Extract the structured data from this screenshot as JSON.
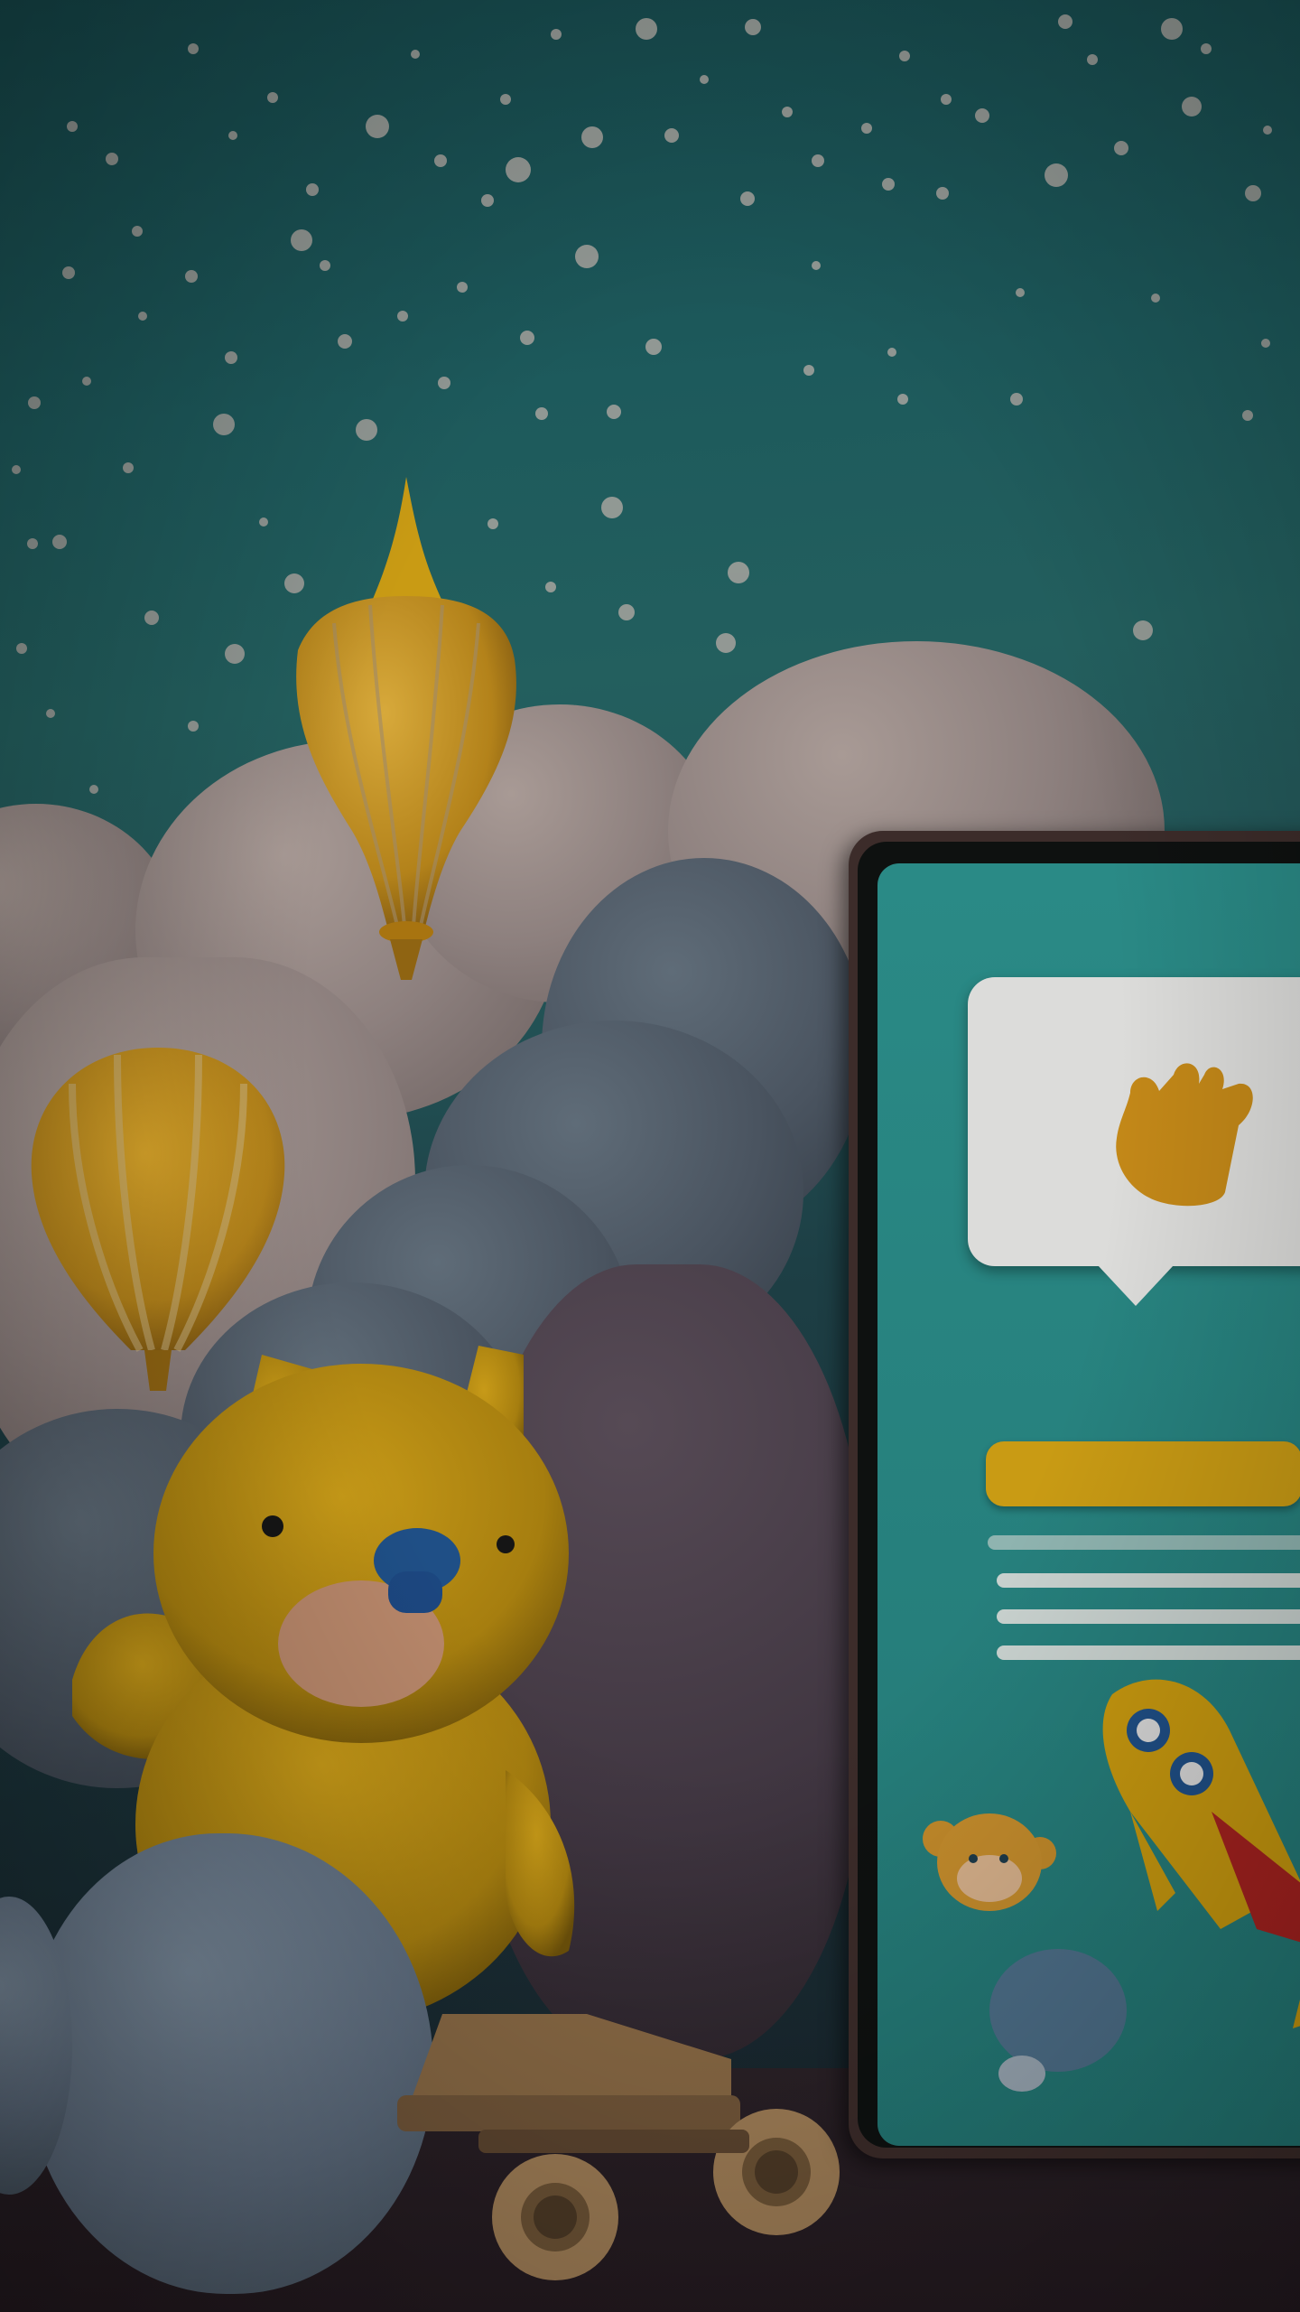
{
  "scene": {
    "elements": {
      "sky": "night-sky-background",
      "stars": "star-dots",
      "balloon_large": "hot-air-balloon-icon",
      "balloon_small": "hot-air-balloon-icon",
      "bear": "teddy-bear-icon",
      "cart": "wooden-cart-icon",
      "phone": "smartphone-icon",
      "hand": "waving-hand-icon",
      "rocket": "rocket-icon",
      "monkey": "monkey-face-icon",
      "blob": "blue-blob-icon"
    },
    "colors": {
      "sky_top": "#16484b",
      "sky_bottom": "#171f27",
      "balloon_yellow": "#c99b14",
      "screen_teal": "#2a8a86",
      "bubble_white": "#dcdcda",
      "bear_yellow": "#b8900f",
      "rocket_red": "#b3262b"
    }
  }
}
